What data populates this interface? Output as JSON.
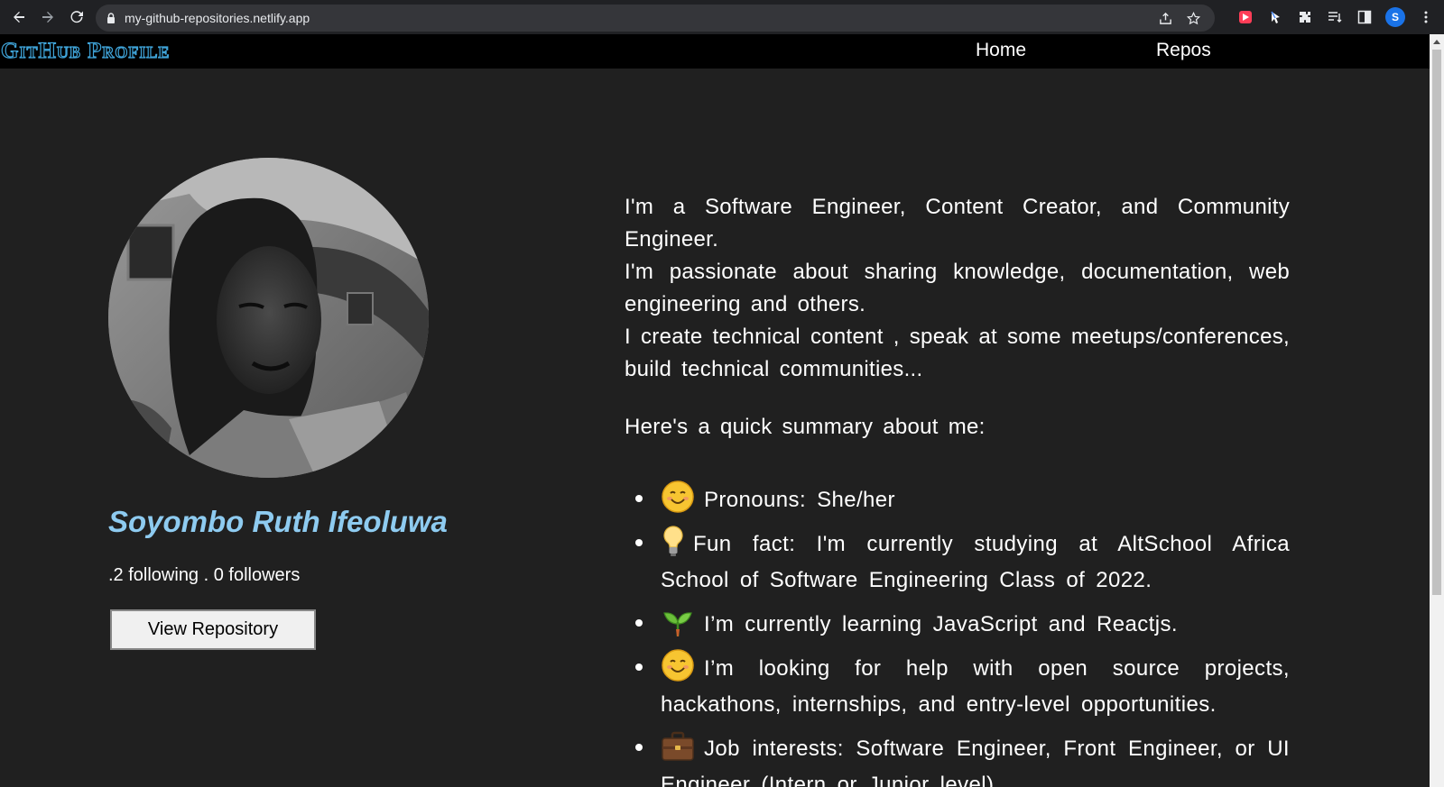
{
  "browser": {
    "url": "my-github-repositories.netlify.app",
    "profile_initial": "S"
  },
  "site": {
    "logo": "GitHub Profile",
    "nav": {
      "home": "Home",
      "repos": "Repos"
    }
  },
  "profile": {
    "name": "Soyombo Ruth Ifeoluwa",
    "stats": ".2 following . 0 followers",
    "view_repo_label": "View Repository"
  },
  "bio": {
    "paragraphs": [
      "I'm a Software Engineer, Content Creator, and Community Engineer.",
      "I'm passionate about sharing knowledge, documentation, web engineering and others.",
      "I create technical content , speak at some meetups/conferences, build technical communities..."
    ],
    "summary_title": "Here's a quick summary about me:",
    "summary": [
      {
        "icon": "smiling-face-icon",
        "text": "Pronouns: She/her"
      },
      {
        "icon": "light-bulb-icon",
        "text": "Fun fact: I'm currently studying at AltSchool Africa School of Software Engineering Class of 2022."
      },
      {
        "icon": "seedling-icon",
        "text": "I’m currently learning JavaScript and Reactjs."
      },
      {
        "icon": "smiling-face-icon",
        "text": "I’m looking for help with open source projects, hackathons, internships, and entry-level opportunities."
      },
      {
        "icon": "briefcase-icon",
        "text": "Job interests: Software Engineer, Front Engineer, or UI Engineer (Intern or Junior level)"
      }
    ]
  },
  "colors": {
    "page_bg": "#202020",
    "header_bg": "#000000",
    "name_color": "#8ecbf0",
    "logo_stroke": "#3fa3d8"
  }
}
